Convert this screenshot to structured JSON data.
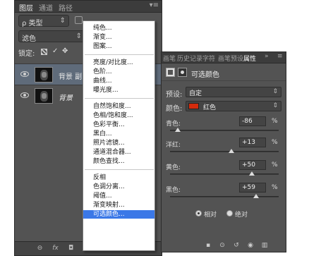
{
  "layers_panel": {
    "tabs": [
      "图层",
      "通道",
      "路径"
    ],
    "filter_kind": "ρ 类型",
    "blend_mode": "滤色",
    "lock_label": "锁定:",
    "layers": [
      {
        "name": "背景 副"
      },
      {
        "name": "背景"
      }
    ],
    "footer_icons": [
      "link-icon",
      "fx-icon",
      "mask-icon",
      "adjustment-icon",
      "group-icon",
      "new-layer-icon",
      "trash-icon"
    ]
  },
  "adjust_menu": {
    "groups": [
      [
        "纯色...",
        "渐变...",
        "图案..."
      ],
      [
        "亮度/对比度...",
        "色阶...",
        "曲线...",
        "曝光度..."
      ],
      [
        "自然饱和度...",
        "色相/饱和度...",
        "色彩平衡...",
        "黑白...",
        "照片滤镜...",
        "通道混合器...",
        "颜色查找..."
      ],
      [
        "反相",
        "色调分离...",
        "阈值...",
        "渐变映射...",
        "可选颜色..."
      ]
    ],
    "selected": "可选颜色..."
  },
  "properties_panel": {
    "tabs": [
      "画笔",
      "历史记录",
      "字符",
      "画笔预设",
      "属性"
    ],
    "title": "可选颜色",
    "preset_label": "预设:",
    "preset_value": "自定",
    "colors_label": "颜色:",
    "colors_value": "红色",
    "colors_swatch": "#d32b0c",
    "sliders": [
      {
        "label": "青色:",
        "value": "-86",
        "unit": "%",
        "level": -86
      },
      {
        "label": "洋红:",
        "value": "+13",
        "unit": "%",
        "level": 13
      },
      {
        "label": "黄色:",
        "value": "+50",
        "unit": "%",
        "level": 50
      },
      {
        "label": "黑色:",
        "value": "+59",
        "unit": "%",
        "level": 59
      }
    ],
    "mode_relative": "相对",
    "mode_absolute": "绝对",
    "mode_selected": "relative"
  }
}
